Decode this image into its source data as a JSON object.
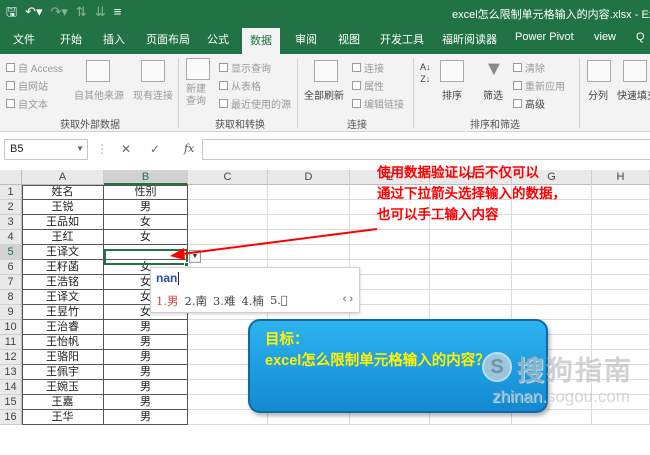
{
  "window": {
    "title": "excel怎么限制单元格输入的内容.xlsx - Exce",
    "qat": [
      "save-icon",
      "undo-icon",
      "redo-icon",
      "sort-icon",
      "customize-icon"
    ]
  },
  "tabs": [
    "文件",
    "开始",
    "插入",
    "页面布局",
    "公式",
    "数据",
    "审阅",
    "视图",
    "开发工具",
    "福昕阅读器",
    "Power Pivot",
    "view",
    "Q"
  ],
  "active_tab": "数据",
  "ribbon": {
    "groups": [
      {
        "label": "获取外部数据",
        "items": [
          "自 Access",
          "自网站",
          "自文本",
          "自其他来源",
          "现有连接"
        ]
      },
      {
        "label": "获取和转换",
        "items": [
          "新建\n查询",
          "显示查询",
          "从表格",
          "最近使用的源"
        ]
      },
      {
        "label": "连接",
        "items": [
          "全部刷新",
          "连接",
          "属性",
          "编辑链接"
        ]
      },
      {
        "label": "排序和筛选",
        "items": [
          "排序",
          "筛选",
          "清除",
          "重新应用",
          "高级"
        ]
      },
      {
        "label": "",
        "items": [
          "分列",
          "快速填充"
        ]
      }
    ]
  },
  "formula_bar": {
    "name_box": "B5",
    "fx": "fx",
    "formula": ""
  },
  "sheet": {
    "columns": [
      "A",
      "B",
      "C",
      "D",
      "E",
      "F",
      "G",
      "H"
    ],
    "active_column": "B",
    "active_row": 5,
    "rows": [
      {
        "n": 1,
        "a": "姓名",
        "b": "性别"
      },
      {
        "n": 2,
        "a": "王锐",
        "b": "男"
      },
      {
        "n": 3,
        "a": "王品如",
        "b": "女"
      },
      {
        "n": 4,
        "a": "王红",
        "b": "女"
      },
      {
        "n": 5,
        "a": "王译文",
        "b": ""
      },
      {
        "n": 6,
        "a": "王籽菡",
        "b": "女"
      },
      {
        "n": 7,
        "a": "王浩铭",
        "b": "女"
      },
      {
        "n": 8,
        "a": "王译文",
        "b": "女"
      },
      {
        "n": 9,
        "a": "王昱竹",
        "b": "女"
      },
      {
        "n": 10,
        "a": "王治睿",
        "b": "男"
      },
      {
        "n": 11,
        "a": "王怡帆",
        "b": "男"
      },
      {
        "n": 12,
        "a": "王骆阳",
        "b": "男"
      },
      {
        "n": 13,
        "a": "王佩宇",
        "b": "男"
      },
      {
        "n": 14,
        "a": "王婉玉",
        "b": "男"
      },
      {
        "n": 15,
        "a": "王嘉",
        "b": "男"
      },
      {
        "n": 16,
        "a": "王华",
        "b": "男"
      }
    ]
  },
  "annotation": {
    "lines": [
      "使用数据验证以后不仅可以",
      "通过下拉箭头选择输入的数据，",
      "也可以手工输入内容"
    ],
    "color": "#ff0000"
  },
  "ime": {
    "input": "nan",
    "candidates": [
      "1.男",
      "2.南",
      "3.难",
      "4.楠",
      "5.𠇉"
    ],
    "nav": "‹ ›"
  },
  "goal_box": {
    "lines": [
      "目标：",
      "excel怎么限制单元格输入的内容？"
    ],
    "text_color": "#fff200",
    "bg_color": "#1e9de3"
  },
  "watermark": {
    "text": "搜狗指南",
    "url": "zhinan.sogou.com"
  },
  "colors": {
    "excel_green": "#217346",
    "ribbon_bg": "#f3f3f3"
  }
}
